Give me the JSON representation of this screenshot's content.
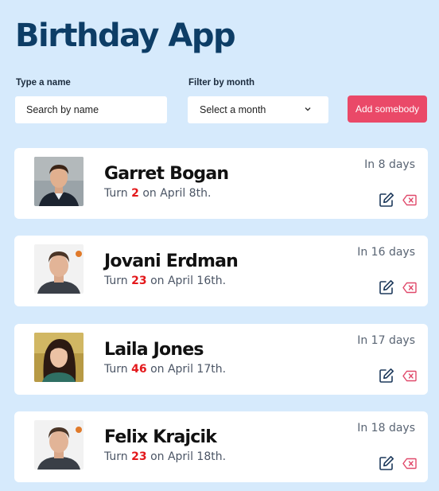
{
  "app": {
    "title": "Birthday App"
  },
  "filters": {
    "name_label": "Type a name",
    "name_placeholder": "Search by name",
    "month_label": "Filter by month",
    "month_value": "Select a month"
  },
  "actions": {
    "add_label": "Add somebody"
  },
  "colors": {
    "background": "#d6eafc",
    "title": "#0d3d66",
    "accent": "#ea4968",
    "age": "#e3181b"
  },
  "people": [
    {
      "name": "Garret Bogan",
      "turn": "Turn",
      "age": "2",
      "date": "on April 8th.",
      "days": "In 8 days"
    },
    {
      "name": "Jovani Erdman",
      "turn": "Turn",
      "age": "23",
      "date": "on April 16th.",
      "days": "In 16 days"
    },
    {
      "name": "Laila Jones",
      "turn": "Turn",
      "age": "46",
      "date": "on April 17th.",
      "days": "In 17 days"
    },
    {
      "name": "Felix Krajcik",
      "turn": "Turn",
      "age": "23",
      "date": "on April 18th.",
      "days": "In 18 days"
    }
  ]
}
